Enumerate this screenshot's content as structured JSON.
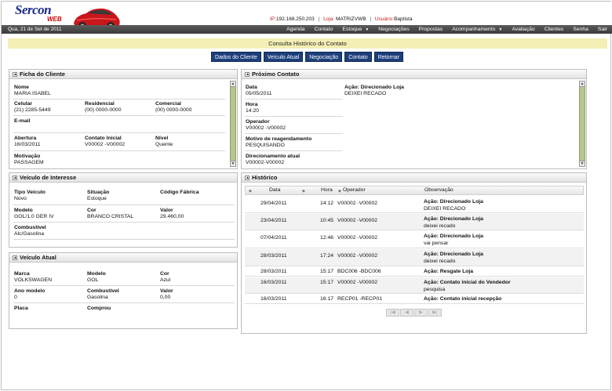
{
  "header": {
    "logo_main": "Sercon",
    "logo_sub": "WEB",
    "ip_label": "IP:",
    "ip_value": "192.168.250.203",
    "loja_label": "Loja:",
    "loja_value": "MATRIZVWB",
    "usuario_label": "Usuário:",
    "usuario_value": "Baptista"
  },
  "nav": {
    "date": "Qua, 21 de Set de 2011",
    "menu": [
      "Agenda",
      "Contato",
      "Estoque",
      "Negociações",
      "Propostas",
      "Acompanhamento",
      "Avaliação",
      "Clientes",
      "Senha",
      "Sair"
    ]
  },
  "page": {
    "title": "Consulta Histórico do Contato",
    "buttons": [
      "Dados do Cliente",
      "Veículo Atual",
      "Negociação",
      "Contato",
      "Retornar"
    ]
  },
  "ficha": {
    "title": "Ficha do Cliente",
    "nome_label": "Nome",
    "nome": "MARIA ISABEL",
    "celular_label": "Celular",
    "celular": "(21) 2285-5449",
    "residencial_label": "Residencial",
    "residencial": "(00) 0000-0000",
    "comercial_label": "Comercial",
    "comercial": "(00) 0000-0000",
    "email_label": "E-mail",
    "email": "",
    "abertura_label": "Abertura",
    "abertura": "16/03/2011",
    "contato_inicial_label": "Contato Inicial",
    "contato_inicial": "V00002 -V00002",
    "nivel_label": "Nível",
    "nivel": "Quente",
    "motivacao_label": "Motivação",
    "motivacao": "PASSAGEM"
  },
  "proximo": {
    "title": "Próximo Contato",
    "data_label": "Data",
    "data": "05/05/2011",
    "acao_label": "Ação: Direcionado Loja",
    "acao": "DEIXEI RECADO",
    "hora_label": "Hora",
    "hora": "14:20",
    "operador_label": "Operador",
    "operador": "V00002 -V00002",
    "motivo_label": "Motivo de reagendamento",
    "motivo": "PESQUISANDO",
    "direcionamento_label": "Direcionamento atual",
    "direcionamento": "V00002-V00002"
  },
  "interesse": {
    "title": "Veículo de Interesse",
    "tipo_label": "Tipo Veículo",
    "tipo": "Novo",
    "situacao_label": "Situação",
    "situacao": "Estoque",
    "codigo_label": "Código Fábrica",
    "codigo": "",
    "modelo_label": "Modelo",
    "modelo": "GOL/1.0 GER IV",
    "cor_label": "Cor",
    "cor": "BRANCO CRISTAL",
    "valor_label": "Valor",
    "valor": "29.460,00",
    "combustivel_label": "Combustível",
    "combustivel": "Alc/Gasolina"
  },
  "atual": {
    "title": "Veículo Atual",
    "marca_label": "Marca",
    "marca": "VOLKSWAGEN",
    "modelo_label": "Modelo",
    "modelo": "GOL",
    "cor_label": "Cor",
    "cor": "Azul",
    "ano_label": "Ano modelo",
    "ano": "0",
    "combustivel_label": "Combustível",
    "combustivel": "Gasolina",
    "valor_label": "Valor",
    "valor": "0,00",
    "placa_label": "Placa",
    "placa": "",
    "comprou_label": "Comprou",
    "comprou": ""
  },
  "historico": {
    "title": "Histórico",
    "columns": [
      "Data",
      "Hora",
      "Operador",
      "Observação"
    ],
    "rows": [
      {
        "data": "29/04/2011",
        "hora": "14:12",
        "operador": "V00002 -V00002",
        "acao": "Ação: Direcionado Loja",
        "obs": "DEIXEI RECADO"
      },
      {
        "data": "23/04/2011",
        "hora": "10:45",
        "operador": "V00002 -V00002",
        "acao": "Ação: Direcionado Loja",
        "obs": "deixei recado"
      },
      {
        "data": "07/04/2011",
        "hora": "12:46",
        "operador": "V00002 -V00002",
        "acao": "Ação: Direcionado Loja",
        "obs": "vai pensar"
      },
      {
        "data": "28/03/2011",
        "hora": "17:24",
        "operador": "V00002 -V00002",
        "acao": "Ação: Direcionado Loja",
        "obs": "deixei recado"
      },
      {
        "data": "28/03/2011",
        "hora": "15:17",
        "operador": "BDC006 -BDC006",
        "acao": "Ação: Resgate Loja",
        "obs": ""
      },
      {
        "data": "16/03/2011",
        "hora": "15:17",
        "operador": "V00002 -V00002",
        "acao": "Ação: Contato inicial do Vendedor",
        "obs": "pesquisa"
      },
      {
        "data": "16/03/2011",
        "hora": "16:17",
        "operador": "RECP01 -RECP01",
        "acao": "Ação: Contato inicial recepção",
        "obs": ""
      }
    ]
  }
}
